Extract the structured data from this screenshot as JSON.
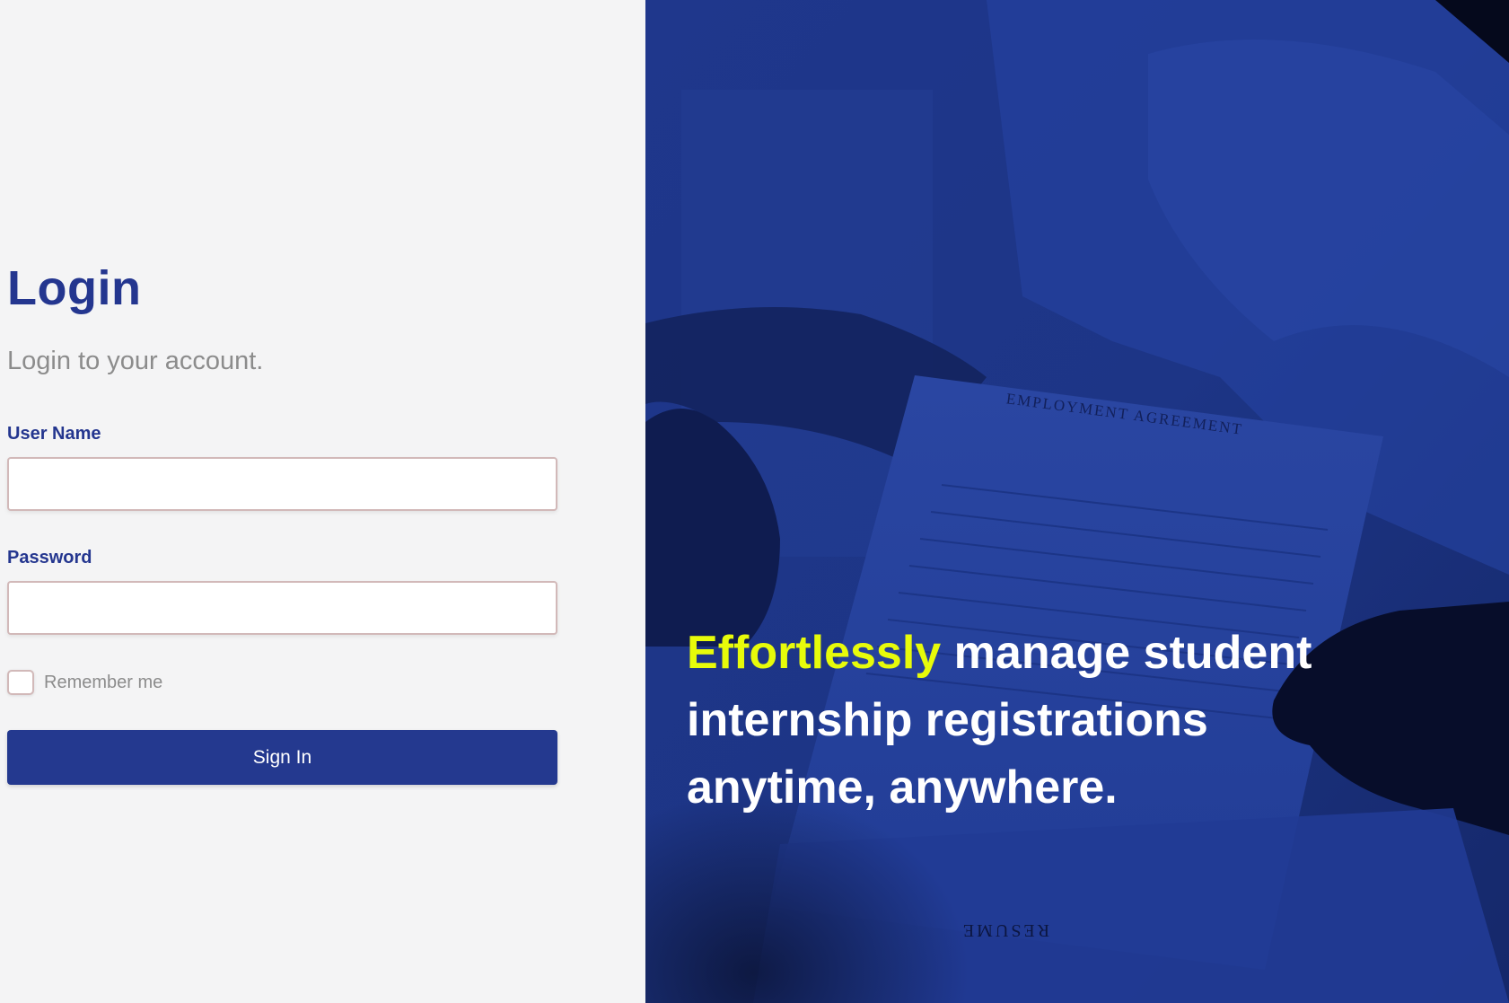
{
  "login": {
    "title": "Login",
    "subtitle": "Login to your account.",
    "username_label": "User Name",
    "username_value": "",
    "password_label": "Password",
    "password_value": "",
    "remember_label": "Remember me",
    "remember_checked": false,
    "signin_label": "Sign In"
  },
  "hero": {
    "highlight": "Effortlessly",
    "line1_rest": "manage student",
    "line2": "internship registrations",
    "line3": "anytime, anywhere.",
    "document_title": "EMPLOYMENT AGREEMENT",
    "resume_text": "RESUME"
  },
  "colors": {
    "brand_blue": "#24398f",
    "highlight_yellow": "#e7fb0a",
    "left_background": "#f4f4f5",
    "muted_text": "#8c8c8c"
  }
}
